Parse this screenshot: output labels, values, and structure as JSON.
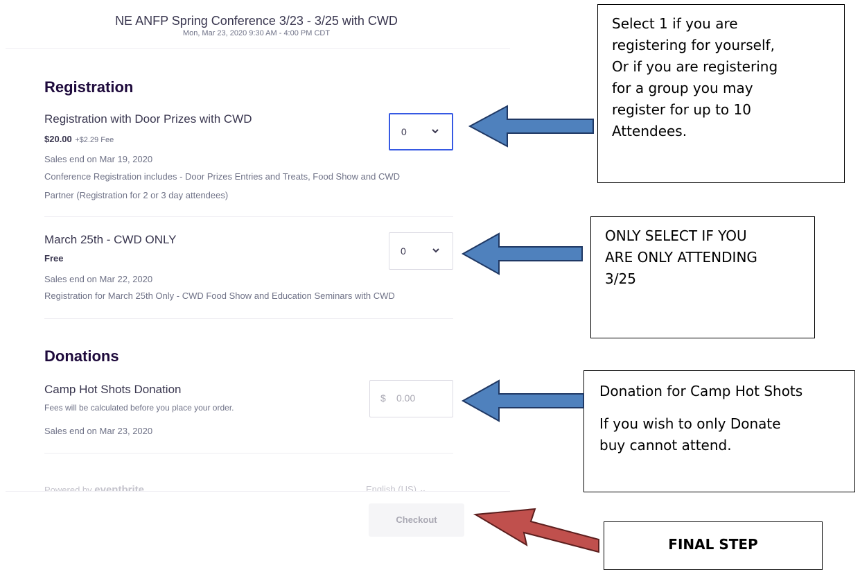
{
  "event": {
    "title": "NE ANFP Spring Conference 3/23 - 3/25 with CWD",
    "date": "Mon, Mar 23, 2020 9:30 AM - 4:00 PM CDT"
  },
  "registration": {
    "heading": "Registration",
    "tickets": [
      {
        "name": "Registration with Door Prizes with CWD",
        "price": "$20.00",
        "fee": "+$2.29 Fee",
        "sales_end": "Sales end on Mar 19, 2020",
        "desc_line1": "Conference Registration includes - Door Prizes Entries and Treats,  Food Show and CWD",
        "desc_line2": "Partner  (Registration for 2 or 3 day attendees)",
        "quantity": "0"
      },
      {
        "name": "March 25th - CWD ONLY",
        "price": "Free",
        "sales_end": "Sales end on Mar 22, 2020",
        "desc_line1": "Registration for March 25th Only - CWD Food Show and Education Seminars with CWD",
        "quantity": "0"
      }
    ]
  },
  "donations": {
    "heading": "Donations",
    "name": "Camp Hot Shots Donation",
    "note": "Fees will be calculated before you place your order.",
    "sales_end": "Sales end on Mar 23, 2020",
    "currency": "$",
    "placeholder": "0.00"
  },
  "footer": {
    "powered_by": "Powered by",
    "brand": "eventbrite",
    "language": "English (US)",
    "checkout_label": "Checkout"
  },
  "callouts": {
    "c1_lines": [
      "Select 1 if you are",
      "registering for yourself,",
      "Or if you are registering",
      "for a group you may",
      "register for up to 10",
      "Attendees."
    ],
    "c2_lines": [
      "ONLY SELECT IF YOU",
      "ARE ONLY ATTENDING",
      "3/25"
    ],
    "c3_line1": "Donation for Camp Hot Shots",
    "c3_line2": "If you wish to only Donate",
    "c3_line3": "buy cannot attend.",
    "c4": "FINAL STEP"
  },
  "colors": {
    "arrow_blue": "#4f81bd",
    "arrow_blue_stroke": "#1f3864",
    "arrow_red": "#c0504d",
    "arrow_red_stroke": "#5c1f1e",
    "focus_blue": "#3659e3"
  }
}
